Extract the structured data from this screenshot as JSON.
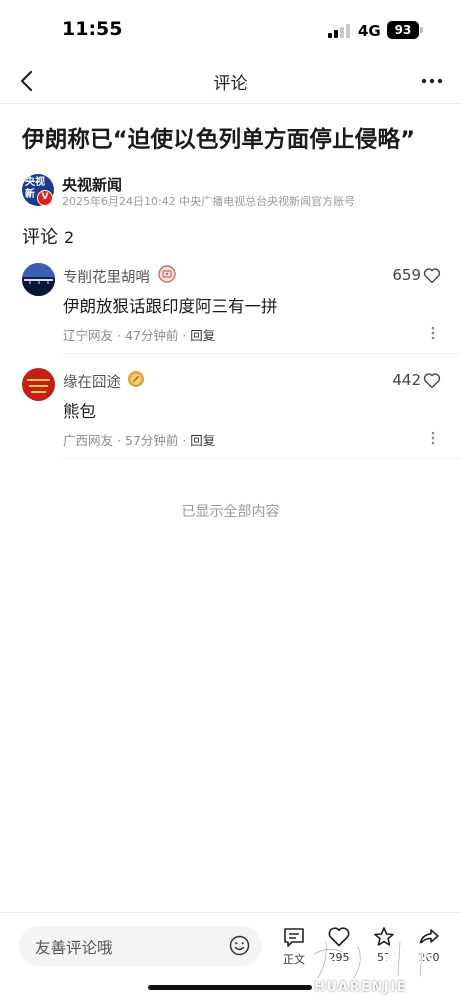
{
  "status_bar": {
    "time": "11:55",
    "network": "4G",
    "battery": "93"
  },
  "nav": {
    "title": "评论",
    "back_icon": "chevron-left-icon",
    "more_icon": "more-horizontal-icon"
  },
  "article": {
    "title": "伊朗称已“迫使以色列单方面停止侵略”",
    "source": {
      "logo_text_top": "央视",
      "logo_text_bottom": "新",
      "verified_mark": "V",
      "name": "央视新闻",
      "meta": "2025年6月24日10:42 中央广播电视总台央视新闻官方账号"
    }
  },
  "comments_heading": {
    "label": "评论",
    "count": "2"
  },
  "comments": [
    {
      "user": "专削花里胡哨",
      "text": "伊朗放狠话跟印度阿三有一拼",
      "likes": "659",
      "location": "辽宁网友",
      "time": "47分钟前",
      "reply_label": "回复"
    },
    {
      "user": "缘在囧途",
      "text": "熊包",
      "likes": "442",
      "location": "广西网友",
      "time": "57分钟前",
      "reply_label": "回复"
    }
  ],
  "end_note": "已显示全部内容",
  "bottom_bar": {
    "input_placeholder": "友善评论哦",
    "article_label": "正文",
    "likes": "295",
    "favorites": "57",
    "shares": "260"
  },
  "watermark": "HUARENJIE",
  "colors": {
    "accent_red": "#e2231a",
    "logo_blue": "#1b3b8c",
    "meta_gray": "#8c8c8c"
  }
}
